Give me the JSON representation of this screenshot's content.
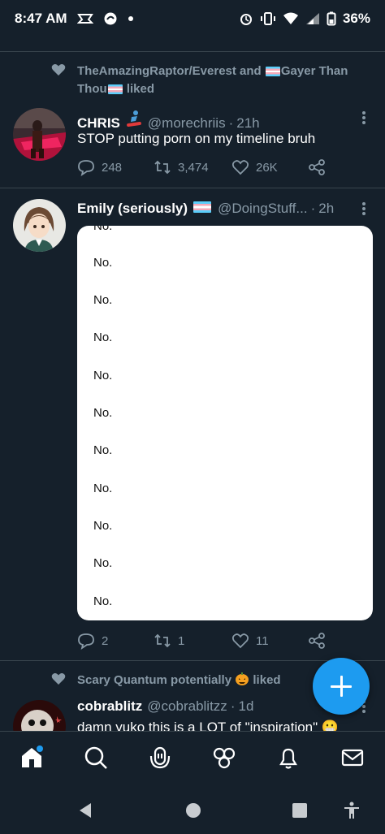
{
  "status_bar": {
    "time": "8:47 AM",
    "battery": "36%"
  },
  "feed": [
    {
      "social_context": {
        "prefix": "TheAmazingRaptor/Everest and ",
        "middle": "Gayer Than Thou",
        "suffix": " liked"
      },
      "author": {
        "name": "CHRIS",
        "handle": "@morechriis",
        "time": "21h"
      },
      "text": "STOP putting porn on my timeline bruh",
      "stats": {
        "replies": "248",
        "retweets": "3,474",
        "likes": "26K"
      }
    },
    {
      "author": {
        "name": "Emily (seriously)",
        "handle": "@DoingStuff...",
        "time": "2h"
      },
      "card_lines": [
        "No.",
        "No.",
        "No.",
        "No.",
        "No.",
        "No.",
        "No.",
        "No.",
        "No.",
        "No.",
        "No."
      ],
      "stats": {
        "replies": "2",
        "retweets": "1",
        "likes": "11"
      }
    },
    {
      "social_context": {
        "prefix": "Scary Quantum potentially ",
        "suffix": " liked"
      },
      "author": {
        "name": "cobrablitz",
        "handle": "@cobrablitzz",
        "time": "1d"
      },
      "text": "damn yuko this is a LOT of \"inspiration\" 😬"
    }
  ],
  "bottom_nav": [
    "home-icon",
    "search-icon",
    "spaces-icon",
    "communities-icon",
    "notifications-icon",
    "messages-icon"
  ],
  "colors": {
    "background": "#15202b",
    "accent": "#1d9bf0",
    "muted": "#8899a6"
  }
}
